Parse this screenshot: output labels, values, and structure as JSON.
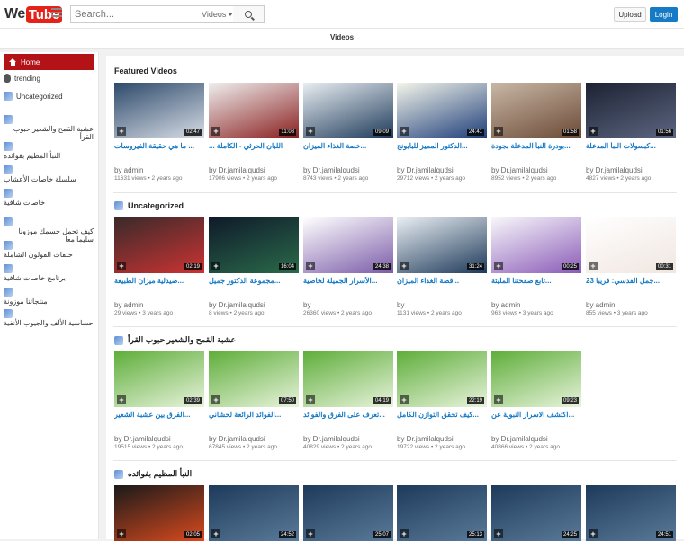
{
  "logo": {
    "we": "We",
    "tube": "Tube"
  },
  "search": {
    "placeholder": "Search...",
    "value": "Search...",
    "filter": "Videos"
  },
  "header": {
    "upload": "Upload",
    "login": "Login"
  },
  "subbar": {
    "title": "Videos"
  },
  "sidebar": {
    "items": [
      {
        "label": "Home",
        "icon": "home-icon"
      },
      {
        "label": "trending",
        "icon": "fire-icon"
      },
      {
        "label": "Uncategorized",
        "icon": "channel-icon"
      },
      {
        "label": "عشبة القمح والشعير حبوب القرأ",
        "icon": "channel-icon"
      },
      {
        "label": "النبأ المظيم بفوائده",
        "icon": "channel-icon"
      },
      {
        "label": "سلسلة خاصات الأعشاب",
        "icon": "channel-icon"
      },
      {
        "label": "خاصات شافية",
        "icon": "channel-icon"
      },
      {
        "label": "كيف تحمل جسمك موزونا سليما معا",
        "icon": "channel-icon"
      },
      {
        "label": "حلقات الفولون الشاملة",
        "icon": "channel-icon"
      },
      {
        "label": "برنامج خاصات شافية",
        "icon": "channel-icon"
      },
      {
        "label": "منتجاتنا موزونة",
        "icon": "channel-icon"
      },
      {
        "label": "حساسية الألف والجيوب الأنفية",
        "icon": "channel-icon"
      }
    ]
  },
  "sections": [
    {
      "title": "Featured Videos",
      "icon": "",
      "videos": [
        {
          "title": "... ما هي حقيقة الفيروسات",
          "author": "by admin",
          "views": "11631 views",
          "age": "2 years ago",
          "duration": "02:47",
          "colors": [
            "#2d4a6b",
            "#d8dde6"
          ]
        },
        {
          "title": "اللبان الحرثي - الكاملة ...",
          "author": "by Dr.jamilalqudsi",
          "views": "17906 views",
          "age": "2 years ago",
          "duration": "11:08",
          "colors": [
            "#efefef",
            "#8a1f1f"
          ]
        },
        {
          "title": "...خصة الغذاء الميزان",
          "author": "by Dr.jamilalqudsi",
          "views": "8743 views",
          "age": "2 years ago",
          "duration": "09:09",
          "colors": [
            "#e9eef2",
            "#1e3a5a"
          ]
        },
        {
          "title": "...الدكتور المميز للبابونج",
          "author": "by Dr.jamilalqudsi",
          "views": "29712 views",
          "age": "2 years ago",
          "duration": "24:41",
          "colors": [
            "#f4f6ea",
            "#1e3d7a"
          ]
        },
        {
          "title": "...بودرة النبأ المدعلة بجودة",
          "author": "by Dr.jamilalqudsi",
          "views": "8952 views",
          "age": "2 years ago",
          "duration": "01:58",
          "colors": [
            "#c9b7a6",
            "#6b4a36"
          ]
        },
        {
          "title": "...كبسولات النبأ المدعلة",
          "author": "by Dr.jamilalqudsi",
          "views": "4827 views",
          "age": "2 years ago",
          "duration": "01:56",
          "colors": [
            "#1d2233",
            "#5c6680"
          ]
        }
      ]
    },
    {
      "title": "Uncategorized",
      "icon": "channel-icon",
      "videos": [
        {
          "title": "...صيدلية ميزان الطبيعة",
          "author": "by admin",
          "views": "29 views",
          "age": "3 years ago",
          "duration": "02:19",
          "colors": [
            "#3a2a2a",
            "#c33"
          ]
        },
        {
          "title": "...مجموعة الدكتور جميل",
          "author": "by Dr.jamilalqudsi",
          "views": "8 views",
          "age": "2 years ago",
          "duration": "16:04",
          "colors": [
            "#0f1a2a",
            "#2a6a4a"
          ]
        },
        {
          "title": "...الأسرار الجميلة لخاصية",
          "author": "by",
          "views": "26360 views",
          "age": "2 years ago",
          "duration": "24:38",
          "colors": [
            "#ffffff",
            "#7b5ca8"
          ]
        },
        {
          "title": "...قصة الغذاء الميزان",
          "author": "by",
          "views": "1131 views",
          "age": "2 years ago",
          "duration": "31:24",
          "colors": [
            "#e9eef2",
            "#1e3a5a"
          ]
        },
        {
          "title": "...تابع صفحتنا المليئة",
          "author": "by admin",
          "views": "963 views",
          "age": "3 years ago",
          "duration": "00:25",
          "colors": [
            "#f7f7fa",
            "#8b5bb8"
          ]
        },
        {
          "title": "...جمل القدسي: قريبا 23",
          "author": "by admin",
          "views": "855 views",
          "age": "3 years ago",
          "duration": "00:31",
          "colors": [
            "#ffffff",
            "#f0e6e0"
          ]
        }
      ]
    },
    {
      "title": "عشبة القمح والشعير حبوب القرأ",
      "icon": "channel-icon",
      "videos": [
        {
          "title": "...الفرق بين عشبة الشعير",
          "author": "by Dr.jamilalqudsi",
          "views": "19515 views",
          "age": "2 years ago",
          "duration": "02:39",
          "colors": [
            "#5fae3b",
            "#e8f3dc"
          ]
        },
        {
          "title": "...الفوائد الرائعة لحشاني",
          "author": "by Dr.jamilalqudsi",
          "views": "67845 views",
          "age": "2 years ago",
          "duration": "07:50",
          "colors": [
            "#5fae3b",
            "#e8f3dc"
          ]
        },
        {
          "title": "...تعرف على الفرق والفوائد",
          "author": "by Dr.jamilalqudsi",
          "views": "40829 views",
          "age": "2 years ago",
          "duration": "04:19",
          "colors": [
            "#5fae3b",
            "#e8f3dc"
          ]
        },
        {
          "title": "...كيف تحقق التوازن الكامل",
          "author": "by Dr.jamilalqudsi",
          "views": "19722 views",
          "age": "2 years ago",
          "duration": "22:19",
          "colors": [
            "#5fae3b",
            "#e8f3dc"
          ]
        },
        {
          "title": "...اكتشف الاسرار النبوية عن",
          "author": "by Dr.jamilalqudsi",
          "views": "40866 views",
          "age": "2 years ago",
          "duration": "09:23",
          "colors": [
            "#5fae3b",
            "#e8f3dc"
          ]
        }
      ]
    },
    {
      "title": "النبأ المظيم بفوائده",
      "icon": "channel-icon",
      "videos": [
        {
          "title": "",
          "author": "",
          "views": "",
          "age": "",
          "duration": "02:05",
          "colors": [
            "#1a1a1a",
            "#d94a1e"
          ]
        },
        {
          "title": "",
          "author": "",
          "views": "",
          "age": "",
          "duration": "24:52",
          "colors": [
            "#1e3a5a",
            "#5a7a9a"
          ]
        },
        {
          "title": "",
          "author": "",
          "views": "",
          "age": "",
          "duration": "25:07",
          "colors": [
            "#1e3a5a",
            "#5a7a9a"
          ]
        },
        {
          "title": "",
          "author": "",
          "views": "",
          "age": "",
          "duration": "25:13",
          "colors": [
            "#1e3a5a",
            "#5a7a9a"
          ]
        },
        {
          "title": "",
          "author": "",
          "views": "",
          "age": "",
          "duration": "24:25",
          "colors": [
            "#1e3a5a",
            "#5a7a9a"
          ]
        },
        {
          "title": "",
          "author": "",
          "views": "",
          "age": "",
          "duration": "24:51",
          "colors": [
            "#1e3a5a",
            "#5a7a9a"
          ]
        }
      ]
    }
  ],
  "colors": {
    "accent": "#b31217",
    "link": "#167ac6",
    "login": "#167ac6"
  }
}
